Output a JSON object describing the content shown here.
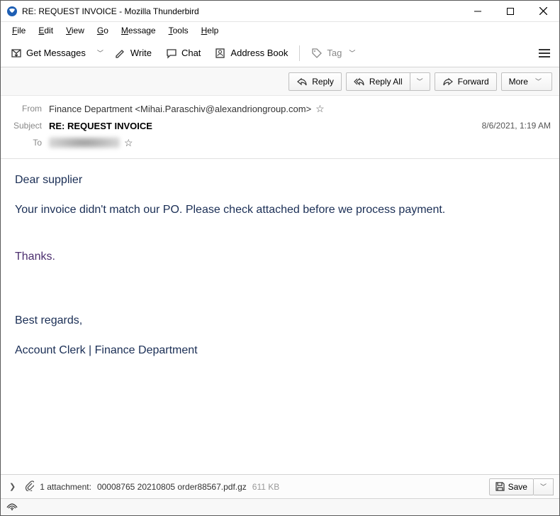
{
  "window": {
    "title": "RE: REQUEST INVOICE - Mozilla Thunderbird"
  },
  "menu": {
    "file": "File",
    "edit": "Edit",
    "view": "View",
    "go": "Go",
    "message": "Message",
    "tools": "Tools",
    "help": "Help"
  },
  "toolbar": {
    "get_messages": "Get Messages",
    "write": "Write",
    "chat": "Chat",
    "address_book": "Address Book",
    "tag": "Tag"
  },
  "actions": {
    "reply": "Reply",
    "reply_all": "Reply All",
    "forward": "Forward",
    "more": "More"
  },
  "headers": {
    "from_label": "From",
    "from_value": "Finance Department <Mihai.Paraschiv@alexandriongroup.com>",
    "subject_label": "Subject",
    "subject_value": "RE: REQUEST INVOICE",
    "date": "8/6/2021, 1:19 AM",
    "to_label": "To"
  },
  "body": {
    "greeting": "Dear supplier",
    "line1": "Your invoice didn't match our PO. Please check attached before we process payment.",
    "thanks": "Thanks.",
    "regards": "Best regards,",
    "signature": "Account Clerk | Finance Department"
  },
  "attachment": {
    "count_text": "1 attachment:",
    "filename": "00008765 20210805 order88567.pdf.gz",
    "size": "611 KB",
    "save": "Save"
  }
}
